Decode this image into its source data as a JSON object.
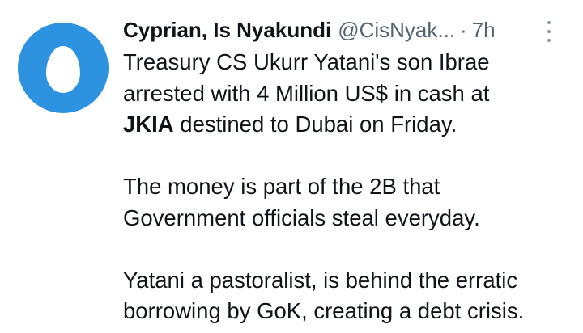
{
  "tweet": {
    "author_name": "Cyprian, Is Nyakundi",
    "handle": "@CisNyak...",
    "separator": "·",
    "time": "7h",
    "more_icon": "more-vertical-icon",
    "avatar": {
      "icon": "default-egg-avatar",
      "color": "#2d93e0"
    },
    "text": {
      "p1_line1": "Treasury CS Ukurr Yatani's son Ibrae",
      "p1_line2": "arrested with 4 Million US$ in cash at",
      "p1_line3_bold": "JKIA",
      "p1_line3_rest": " destined to Dubai on Friday.",
      "p2_line1": "The money is part of the 2B that",
      "p2_line2": "Government officials steal everyday.",
      "p3_line1": "Yatani a pastoralist, is behind the erratic",
      "p3_line2": "borrowing by GoK, creating a debt crisis."
    }
  }
}
